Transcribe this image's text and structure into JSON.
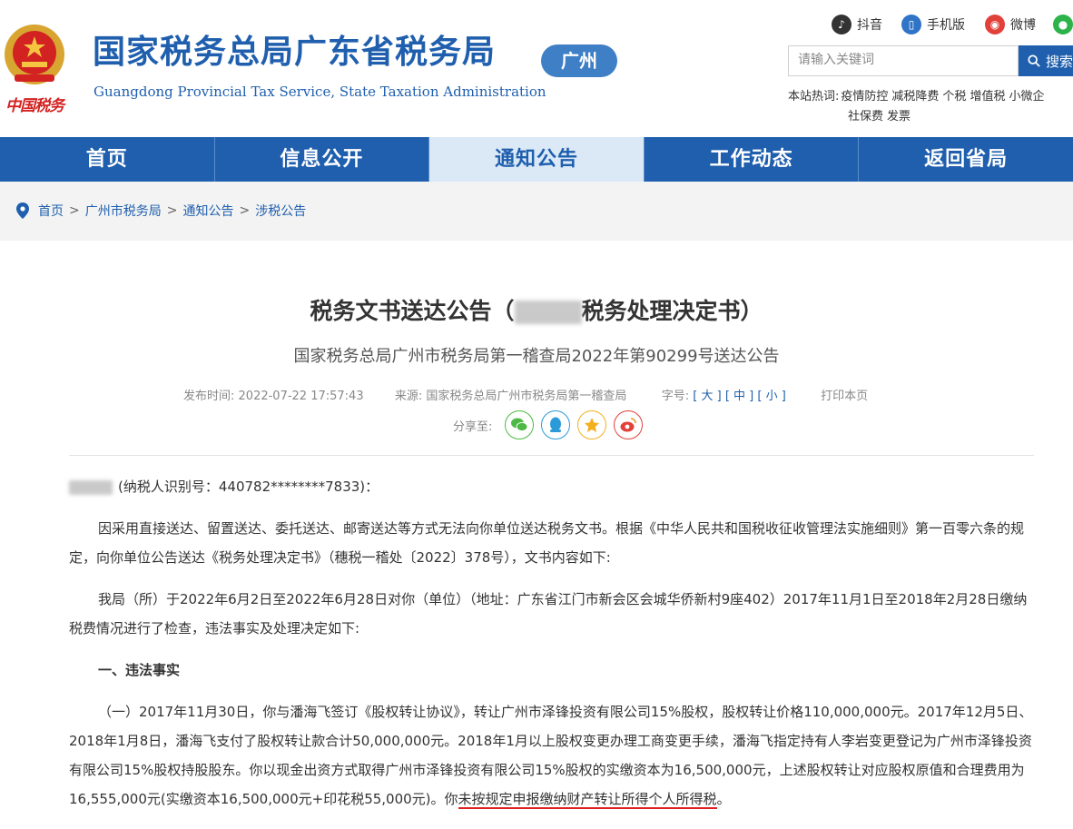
{
  "header": {
    "seal_text": "中国税务",
    "title": "国家税务总局广东省税务局",
    "subtitle": "Guangdong Provincial Tax Service, State Taxation Administration",
    "city_badge": "广州",
    "social": [
      {
        "label": "抖音",
        "icon": "douyin-icon",
        "color": "#333333"
      },
      {
        "label": "手机版",
        "icon": "mobile-icon",
        "color": "#2f74c6"
      },
      {
        "label": "微博",
        "icon": "weibo-icon",
        "color": "#e2413a"
      },
      {
        "label": "",
        "icon": "wechat-icon",
        "color": "#2db34a"
      }
    ],
    "search": {
      "placeholder": "请输入关键词",
      "button": "搜索"
    },
    "hot": {
      "label": "本站热词:",
      "words": [
        "疫情防控",
        "减税降费",
        "个税",
        "增值税",
        "小微企",
        "社保费",
        "发票"
      ]
    }
  },
  "nav": {
    "items": [
      "首页",
      "信息公开",
      "通知公告",
      "工作动态",
      "返回省局"
    ],
    "active_index": 2
  },
  "breadcrumb": [
    "首页",
    "广州市税务局",
    "通知公告",
    "涉税公告"
  ],
  "article": {
    "title_pre": "税务文书送达公告（",
    "title_post": "税务处理决定书）",
    "subtitle": "国家税务总局广州市税务局第一稽查局2022年第90299号送达公告",
    "meta": {
      "time_label": "发布时间:",
      "time": "2022-07-22 17:57:43",
      "source_label": "来源:",
      "source": "国家税务总局广州市税务局第一稽查局",
      "size_label": "字号:",
      "sizes": [
        "大",
        "中",
        "小"
      ],
      "print": "打印本页"
    },
    "share_label": "分享至:",
    "addressee_suffix": "(纳税人识别号：440782********7833)：",
    "para1": "因采用直接送达、留置送达、委托送达、邮寄送达等方式无法向你单位送达税务文书。根据《中华人民共和国税收征收管理法实施细则》第一百零六条的规定，向你单位公告送达《税务处理决定书》（穗税一稽处〔2022〕378号），文书内容如下:",
    "para2": "我局（所）于2022年6月2日至2022年6月28日对你（单位）（地址：广东省江门市新会区会城华侨新村9座402）2017年11月1日至2018年2月28日缴纳税费情况进行了检查，违法事实及处理决定如下:",
    "heading1": "一、违法事实",
    "para3": "（一）2017年11月30日，你与潘海飞签订《股权转让协议》，转让广州市泽锋投资有限公司15%股权，股权转让价格110,000,000元。2017年12月5日、2018年1月8日，潘海飞支付了股权转让款合计50,000,000元。2018年1月以上股权变更办理工商变更手续，潘海飞指定持有人李岩变更登记为广州市泽锋投资有限公司15%股权持股股东。你以现金出资方式取得广州市泽锋投资有限公司15%股权的实缴资本为16,500,000元，上述股权转让对应股权原值和合理费用为16,555,000元(实缴资本16,500,000元+印花税55,000元)。你",
    "para3_highlight": "未按规定申报缴纳财产转让所得个人所得税",
    "para3_end": "。"
  }
}
